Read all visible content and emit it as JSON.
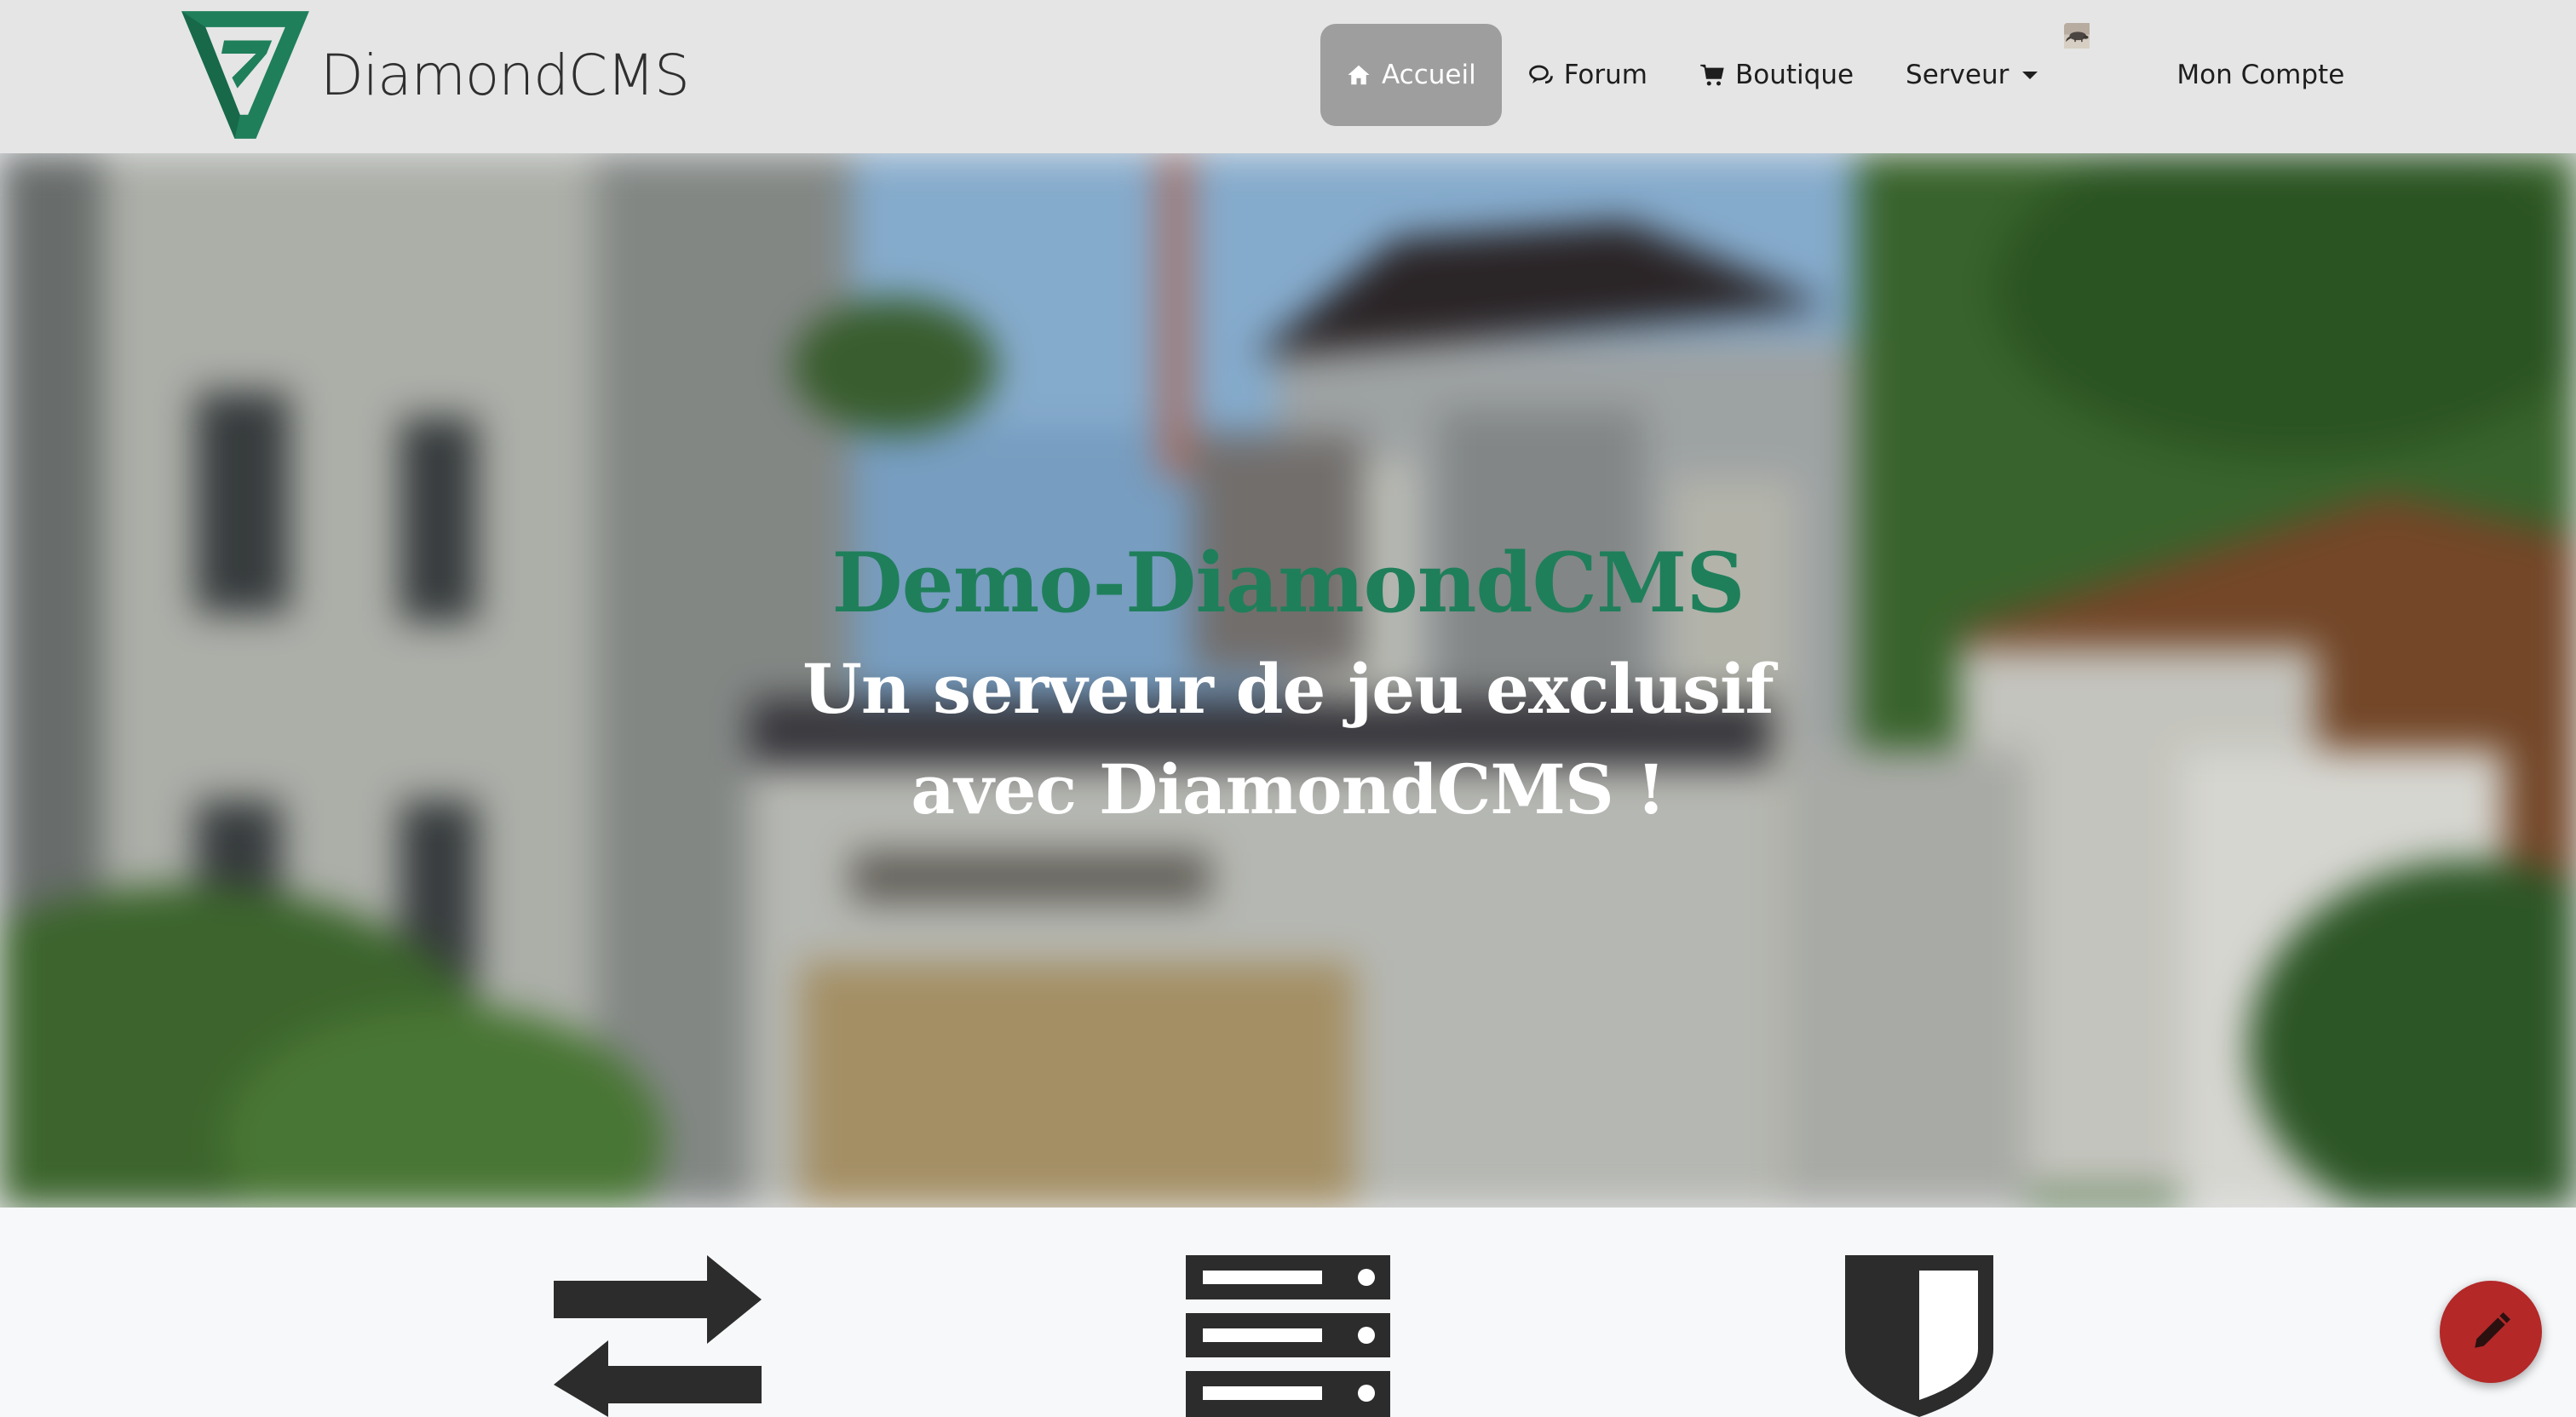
{
  "header": {
    "brand": "DiamondCMS",
    "nav": [
      {
        "label": "Accueil",
        "icon": "home-icon",
        "active": true
      },
      {
        "label": "Forum",
        "icon": "comments-icon",
        "active": false
      },
      {
        "label": "Boutique",
        "icon": "shopping-cart-icon",
        "active": false
      },
      {
        "label": "Serveur",
        "icon": "caret-down-icon",
        "active": false
      }
    ],
    "account_label": "Mon Compte"
  },
  "hero": {
    "title": "Demo-DiamondCMS",
    "subtitle": "Un serveur de jeu exclusif avec DiamondCMS !"
  },
  "features": [
    {
      "icon": "exchange-arrows-icon"
    },
    {
      "icon": "server-icon"
    },
    {
      "icon": "shield-icon"
    }
  ],
  "fab": {
    "icon": "pencil-icon"
  },
  "colors": {
    "brand_green": "#1f7f5b",
    "navbar_bg": "#e5e5e5",
    "active_nav_bg": "#9e9e9e",
    "fab_red": "#b42828"
  }
}
